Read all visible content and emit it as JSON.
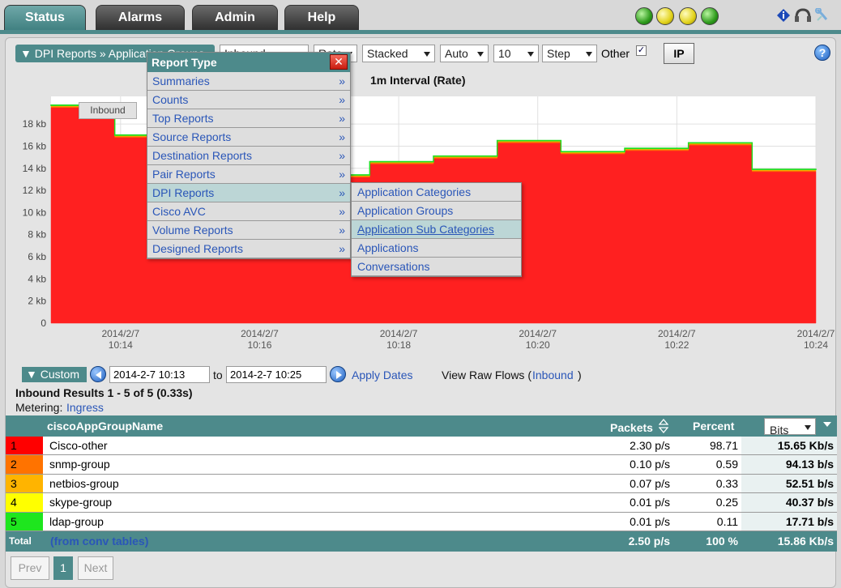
{
  "tabs": [
    {
      "label": "Status",
      "active": true
    },
    {
      "label": "Alarms",
      "active": false
    },
    {
      "label": "Admin",
      "active": false
    },
    {
      "label": "Help",
      "active": false
    }
  ],
  "status_icons": [
    "green-orb-icon",
    "yellow-orb-icon",
    "yellow-orb-icon",
    "green-orb-icon"
  ],
  "toolbar": {
    "breadcrumb": "▼ DPI Reports » Application Groups",
    "direction": "Inbound",
    "rate": "Rate",
    "stack": "Stacked",
    "scale": "Auto",
    "count": "10",
    "mode": "Step",
    "other_label": "Other",
    "other_checked": "✓",
    "ip_label": "IP",
    "help_label": "?"
  },
  "chart_title": "1m Interval (Rate)",
  "inbound_chip": "Inbound",
  "chart_data": {
    "type": "area",
    "step": true,
    "stacked": true,
    "x": [
      "10:13:00",
      "10:14:00",
      "10:15:00",
      "10:16:00",
      "10:17:00",
      "10:18:00",
      "10:19:00",
      "10:20:00",
      "10:21:00",
      "10:22:00",
      "10:23:00",
      "10:24:00"
    ],
    "x_ticks": [
      {
        "x": "10:14:00",
        "label_date": "2014/2/7",
        "label_time": "10:14"
      },
      {
        "x": "10:16:00",
        "label_date": "2014/2/7",
        "label_time": "10:16"
      },
      {
        "x": "10:18:00",
        "label_date": "2014/2/7",
        "label_time": "10:18"
      },
      {
        "x": "10:20:00",
        "label_date": "2014/2/7",
        "label_time": "10:20"
      },
      {
        "x": "10:22:00",
        "label_date": "2014/2/7",
        "label_time": "10:22"
      },
      {
        "x": "10:24:00",
        "label_date": "2014/2/7",
        "label_time": "10:24"
      }
    ],
    "series": [
      {
        "name": "Cisco-other",
        "color": "#ff2020",
        "values": [
          19.5,
          16.8,
          16.5,
          15.0,
          13.2,
          14.4,
          14.9,
          16.3,
          15.3,
          15.6,
          16.1,
          13.7,
          11.2
        ]
      },
      {
        "name": "snmp-group",
        "color": "#ff7000",
        "values": [
          0.1,
          0.1,
          0.1,
          0.1,
          0.1,
          0.1,
          0.1,
          0.1,
          0.1,
          0.1,
          0.1,
          0.1,
          0.1
        ]
      },
      {
        "name": "netbios-group",
        "color": "#ffb300",
        "values": [
          0.05,
          0.05,
          0.05,
          0.05,
          0.05,
          0.05,
          0.05,
          0.05,
          0.05,
          0.05,
          0.05,
          0.05,
          0.05
        ]
      },
      {
        "name": "skype-group",
        "color": "#f7f700",
        "values": [
          0.04,
          0.04,
          0.04,
          0.04,
          0.04,
          0.04,
          0.04,
          0.04,
          0.04,
          0.04,
          0.04,
          0.04,
          0.04
        ]
      },
      {
        "name": "ldap-group",
        "color": "#22dd22",
        "values": [
          0.02,
          0.02,
          0.02,
          0.02,
          0.02,
          0.02,
          0.02,
          0.02,
          0.02,
          0.02,
          0.02,
          0.02,
          0.02
        ]
      }
    ],
    "y_ticks": [
      "0",
      "2 kb",
      "4 kb",
      "6 kb",
      "8 kb",
      "10 kb",
      "12 kb",
      "14 kb",
      "16 kb",
      "18 kb"
    ],
    "ylim": [
      0,
      20.5
    ],
    "grid": true
  },
  "report_menu": {
    "title": "Report Type",
    "close_label": "✕",
    "items": [
      {
        "label": "Summaries",
        "arrow": "»"
      },
      {
        "label": "Counts",
        "arrow": "»"
      },
      {
        "label": "Top Reports",
        "arrow": "»"
      },
      {
        "label": "Source Reports",
        "arrow": "»"
      },
      {
        "label": "Destination Reports",
        "arrow": "»"
      },
      {
        "label": "Pair Reports",
        "arrow": "»"
      },
      {
        "label": "DPI Reports",
        "arrow": "»"
      },
      {
        "label": "Cisco AVC",
        "arrow": "»"
      },
      {
        "label": "Volume Reports",
        "arrow": "»"
      },
      {
        "label": "Designed Reports",
        "arrow": "»"
      }
    ],
    "submenu": [
      {
        "label": "Application Categories"
      },
      {
        "label": "Application Groups"
      },
      {
        "label": "Application Sub Categories"
      },
      {
        "label": "Applications"
      },
      {
        "label": "Conversations"
      }
    ]
  },
  "date_range": {
    "custom_label": "▼ Custom",
    "from": "2014-2-7 10:13",
    "to_label": "to",
    "to": "2014-2-7 10:25",
    "apply_label": "Apply Dates",
    "raw_flows_prefix": "View Raw Flows (",
    "raw_flows_link": "Inbound",
    "raw_flows_suffix": ")"
  },
  "results": {
    "summary": "Inbound Results 1 - 5 of 5 (0.33s)",
    "metering_label": "Metering:",
    "metering_value": "Ingress"
  },
  "table": {
    "col_name": "ciscoAppGroupName",
    "col_packets": "Packets",
    "col_percent": "Percent",
    "bits_select": "Bits",
    "rows": [
      {
        "idx": "1",
        "color": "#ff0000",
        "name": "Cisco-other",
        "packets": "2.30 p/s",
        "percent": "98.71",
        "bits": "15.65 Kb/s"
      },
      {
        "idx": "2",
        "color": "#ff7300",
        "name": "snmp-group",
        "packets": "0.10 p/s",
        "percent": "0.59",
        "bits": "94.13 b/s"
      },
      {
        "idx": "3",
        "color": "#ffb400",
        "name": "netbios-group",
        "packets": "0.07 p/s",
        "percent": "0.33",
        "bits": "52.51 b/s"
      },
      {
        "idx": "4",
        "color": "#ffff00",
        "name": "skype-group",
        "packets": "0.01 p/s",
        "percent": "0.25",
        "bits": "40.37 b/s"
      },
      {
        "idx": "5",
        "color": "#1ee61e",
        "name": "ldap-group",
        "packets": "0.01 p/s",
        "percent": "0.11",
        "bits": "17.71 b/s"
      }
    ],
    "total_label": "Total",
    "total_note": "(from conv tables)",
    "total_packets": "2.50 p/s",
    "total_percent": "100 %",
    "total_bits": "15.86 Kb/s"
  },
  "pager": {
    "prev": "Prev",
    "current": "1",
    "next": "Next"
  }
}
